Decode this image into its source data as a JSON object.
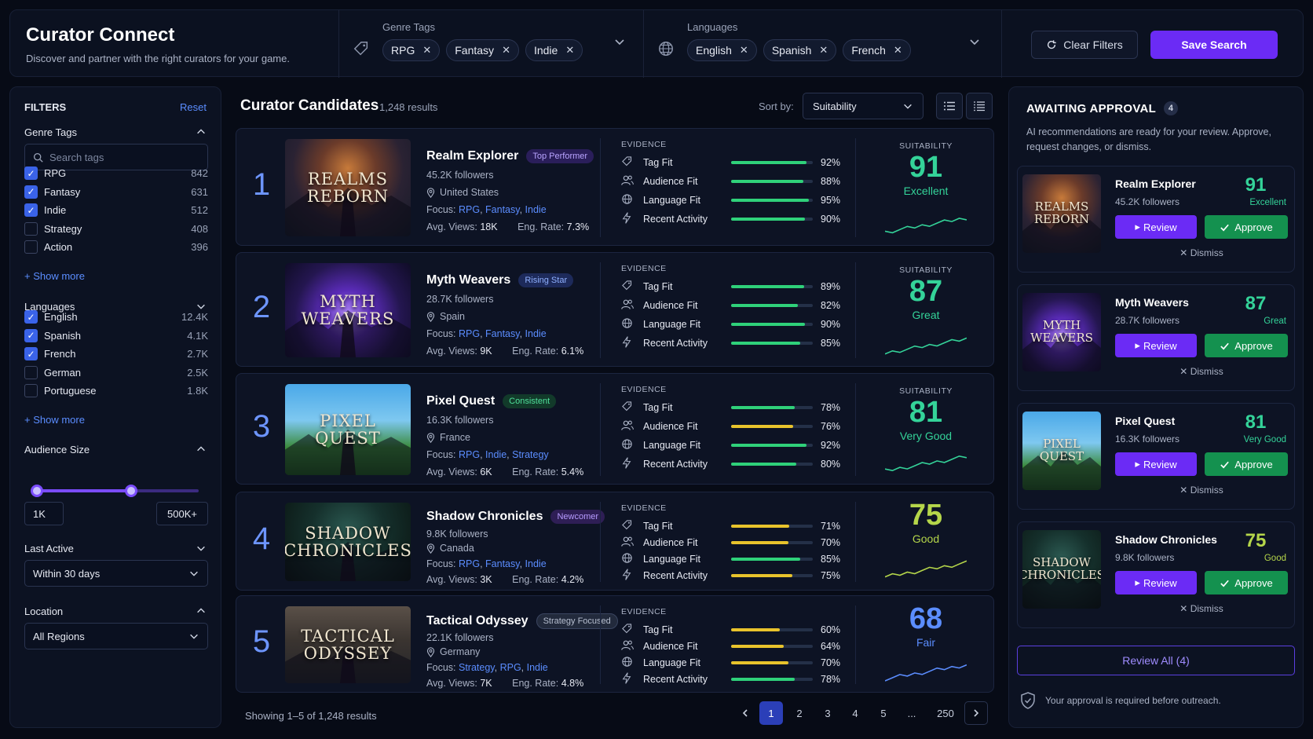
{
  "header": {
    "title": "Curator Connect",
    "subtitle": "Discover and partner with the right curators for your game.",
    "genre_label": "Genre Tags",
    "genre_chips": [
      "RPG",
      "Fantasy",
      "Indie"
    ],
    "lang_label": "Languages",
    "lang_chips": [
      "English",
      "Spanish",
      "French"
    ],
    "clear_label": "Clear Filters",
    "save_label": "Save Search"
  },
  "filters": {
    "title": "FILTERS",
    "reset": "Reset",
    "genre_title": "Genre Tags",
    "search_placeholder": "Search tags",
    "genres": [
      {
        "label": "RPG",
        "count": "842",
        "checked": true
      },
      {
        "label": "Fantasy",
        "count": "631",
        "checked": true
      },
      {
        "label": "Indie",
        "count": "512",
        "checked": true
      },
      {
        "label": "Strategy",
        "count": "408",
        "checked": false
      },
      {
        "label": "Action",
        "count": "396",
        "checked": false
      }
    ],
    "show_more": "Show more",
    "lang_title": "Languages",
    "languages": [
      {
        "label": "English",
        "count": "12.4K",
        "checked": true
      },
      {
        "label": "Spanish",
        "count": "4.1K",
        "checked": true
      },
      {
        "label": "French",
        "count": "2.7K",
        "checked": true
      },
      {
        "label": "German",
        "count": "2.5K",
        "checked": false
      },
      {
        "label": "Portuguese",
        "count": "1.8K",
        "checked": false
      }
    ],
    "audience_title": "Audience Size",
    "audience_min": "1K",
    "audience_max": "500K+",
    "last_active_title": "Last Active",
    "last_active_value": "Within 30 days",
    "location_title": "Location",
    "location_value": "All Regions"
  },
  "main": {
    "title": "Curator Candidates",
    "count": "1,248 results",
    "sort_label": "Sort by:",
    "sort_value": "Suitability",
    "evidence_header": "EVIDENCE",
    "suitability_header": "SUITABILITY",
    "evidence_labels": [
      "Tag Fit",
      "Audience Fit",
      "Language Fit",
      "Recent Activity"
    ],
    "focus_label": "Focus:",
    "views_label": "Avg. Views:",
    "eng_label": "Eng. Rate:",
    "curators": [
      {
        "rank": "1",
        "name": "Realm Explorer",
        "badge": "Top Performer",
        "followers": "45.2K followers",
        "location": "United States",
        "focus": [
          "RPG",
          "Fantasy",
          "Indie"
        ],
        "views": "18K",
        "eng": "7.3%",
        "evidence": [
          "92%",
          "88%",
          "95%",
          "90%"
        ],
        "score": "91",
        "word": "Excellent",
        "thumb": "REALMS\nREBORN"
      },
      {
        "rank": "2",
        "name": "Myth Weavers",
        "badge": "Rising Star",
        "followers": "28.7K followers",
        "location": "Spain",
        "focus": [
          "RPG",
          "Fantasy",
          "Indie"
        ],
        "views": "9K",
        "eng": "6.1%",
        "evidence": [
          "89%",
          "82%",
          "90%",
          "85%"
        ],
        "score": "87",
        "word": "Great",
        "thumb": "MYTH\nWEAVERS"
      },
      {
        "rank": "3",
        "name": "Pixel Quest",
        "badge": "Consistent",
        "followers": "16.3K followers",
        "location": "France",
        "focus": [
          "RPG",
          "Indie",
          "Strategy"
        ],
        "views": "6K",
        "eng": "5.4%",
        "evidence": [
          "78%",
          "76%",
          "92%",
          "80%"
        ],
        "score": "81",
        "word": "Very Good",
        "thumb": "PIXEL\nQUEST"
      },
      {
        "rank": "4",
        "name": "Shadow Chronicles",
        "badge": "Newcomer",
        "followers": "9.8K followers",
        "location": "Canada",
        "focus": [
          "RPG",
          "Fantasy",
          "Indie"
        ],
        "views": "3K",
        "eng": "4.2%",
        "evidence": [
          "71%",
          "70%",
          "85%",
          "75%"
        ],
        "score": "75",
        "word": "Good",
        "thumb": "SHADOW\nCHRONICLES"
      },
      {
        "rank": "5",
        "name": "Tactical Odyssey",
        "badge": "Strategy Focused",
        "followers": "22.1K followers",
        "location": "Germany",
        "focus": [
          "Strategy",
          "RPG",
          "Indie"
        ],
        "views": "7K",
        "eng": "4.8%",
        "evidence": [
          "60%",
          "64%",
          "70%",
          "78%"
        ],
        "score": "68",
        "word": "Fair",
        "thumb": "TACTICAL\nODYSSEY"
      }
    ],
    "showing": "Showing 1–5 of 1,248 results",
    "pages": [
      "1",
      "2",
      "3",
      "4",
      "5",
      "...",
      "250"
    ]
  },
  "approval": {
    "title": "AWAITING APPROVAL",
    "count": "4",
    "desc": "AI recommendations are ready for your review. Approve, request changes, or dismiss.",
    "review_label": "Review",
    "approve_label": "Approve",
    "dismiss_label": "Dismiss",
    "items": [
      {
        "name": "Realm Explorer",
        "followers": "45.2K followers",
        "score": "91",
        "word": "Excellent",
        "thumb": "REALMS\nREBORN"
      },
      {
        "name": "Myth Weavers",
        "followers": "28.7K followers",
        "score": "87",
        "word": "Great",
        "thumb": "MYTH\nWEAVERS"
      },
      {
        "name": "Pixel Quest",
        "followers": "16.3K followers",
        "score": "81",
        "word": "Very Good",
        "thumb": "PIXEL\nQUEST"
      },
      {
        "name": "Shadow Chronicles",
        "followers": "9.8K followers",
        "score": "75",
        "word": "Good",
        "thumb": "SHADOW\nCHRONICLES"
      }
    ],
    "review_all": "Review All (4)",
    "note": "Your approval is required before outreach."
  },
  "colors": {
    "accent": "#6b2bf5",
    "link": "#5b8dff",
    "green": "#2fd17a",
    "yellow": "#e8c32c",
    "approve": "#14914f",
    "score_91": "#34d399",
    "score_87": "#34d399",
    "score_81": "#34d399",
    "score_75": "#b5d64a",
    "score_68": "#5b8dff"
  }
}
